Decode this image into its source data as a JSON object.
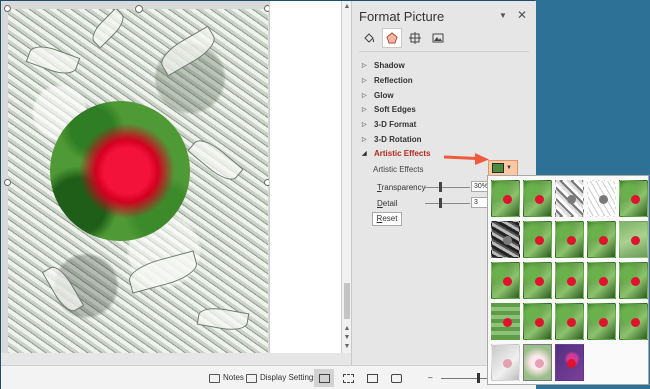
{
  "pane": {
    "title": "Format Picture",
    "tabs": [
      {
        "name": "fill-line-tab",
        "icon": "paint-bucket-icon"
      },
      {
        "name": "effects-tab",
        "icon": "pentagon-effects-icon",
        "active": true
      },
      {
        "name": "size-properties-tab",
        "icon": "size-properties-icon"
      },
      {
        "name": "picture-tab",
        "icon": "picture-icon"
      }
    ],
    "sections": [
      {
        "label": "Shadow",
        "expanded": false
      },
      {
        "label": "Reflection",
        "expanded": false
      },
      {
        "label": "Glow",
        "expanded": false
      },
      {
        "label": "Soft Edges",
        "expanded": false
      },
      {
        "label": "3-D Format",
        "expanded": false
      },
      {
        "label": "3-D Rotation",
        "expanded": false
      },
      {
        "label": "Artistic Effects",
        "expanded": true
      }
    ],
    "artistic_effects": {
      "label": "Artistic Effects",
      "transparency": {
        "label_prefix": "T",
        "label_rest": "ransparency",
        "value": "30%",
        "fraction": 0.3
      },
      "detail": {
        "label_prefix": "D",
        "label_rest": "etail",
        "value": "3",
        "fraction": 0.3
      },
      "reset_prefix": "R",
      "reset_rest": "eset"
    }
  },
  "gallery": {
    "rows": 5,
    "columns": 5,
    "item_count": 23,
    "selected_index": 21
  },
  "status_bar": {
    "notes_label": "Notes",
    "display_settings_label": "Display Settings",
    "zoom_minus": "–",
    "zoom_plus": "+"
  },
  "colors": {
    "accent_red": "#b32a1d",
    "callout_arrow": "#f05a3e",
    "desktop": "#2e7196"
  }
}
